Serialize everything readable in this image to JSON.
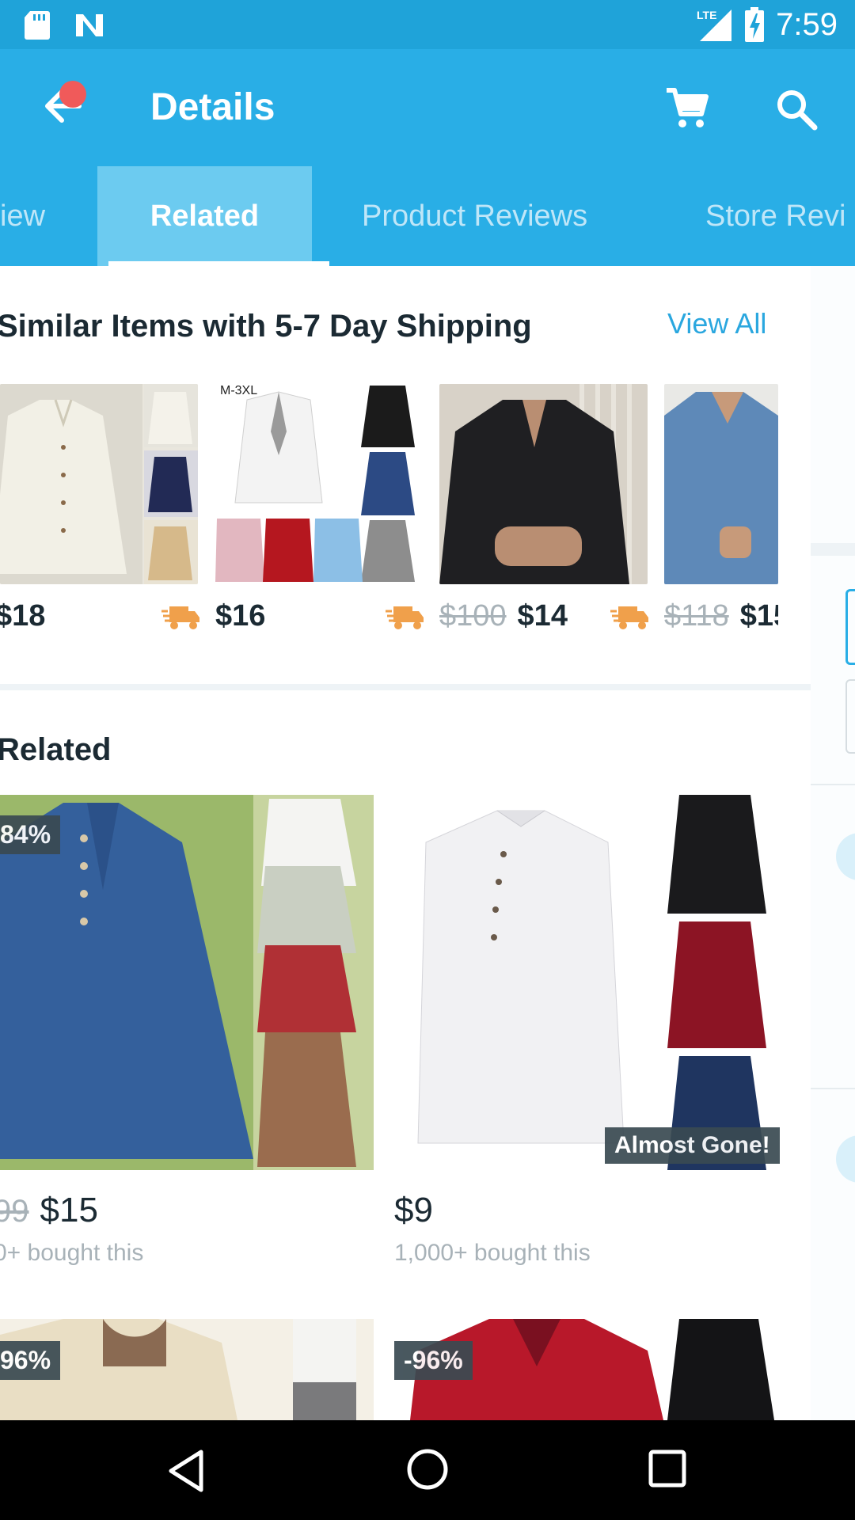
{
  "status_bar": {
    "time": "7:59",
    "network": "LTE"
  },
  "app_bar": {
    "title": "Details"
  },
  "tabs": [
    "iew",
    "Related",
    "Product Reviews",
    "Store Revi"
  ],
  "similar": {
    "title": "Similar Items with 5-7 Day Shipping",
    "view_all": "View All",
    "items": [
      {
        "price": "$18",
        "old_price": "",
        "size_label": ""
      },
      {
        "price": "$16",
        "old_price": "",
        "size_label": "M-3XL"
      },
      {
        "price": "$14",
        "old_price": "$100",
        "size_label": ""
      },
      {
        "price": "$15",
        "old_price": "$118",
        "size_label": ""
      }
    ]
  },
  "related": {
    "title": "Related",
    "cards": [
      {
        "badge": "84%",
        "old_price": "99",
        "price": "$15",
        "sold": "0+ bought this",
        "tag": ""
      },
      {
        "badge": "",
        "old_price": "",
        "price": "$9",
        "sold": "1,000+ bought this",
        "tag": "Almost Gone!"
      },
      {
        "badge": "96%"
      },
      {
        "badge": "-96%"
      }
    ]
  },
  "colors": {
    "primary": "#29aee6",
    "status": "#1fa3d9",
    "accent_link": "#2aa7df",
    "notification": "#f05a5a",
    "truck": "#f0a04b"
  }
}
